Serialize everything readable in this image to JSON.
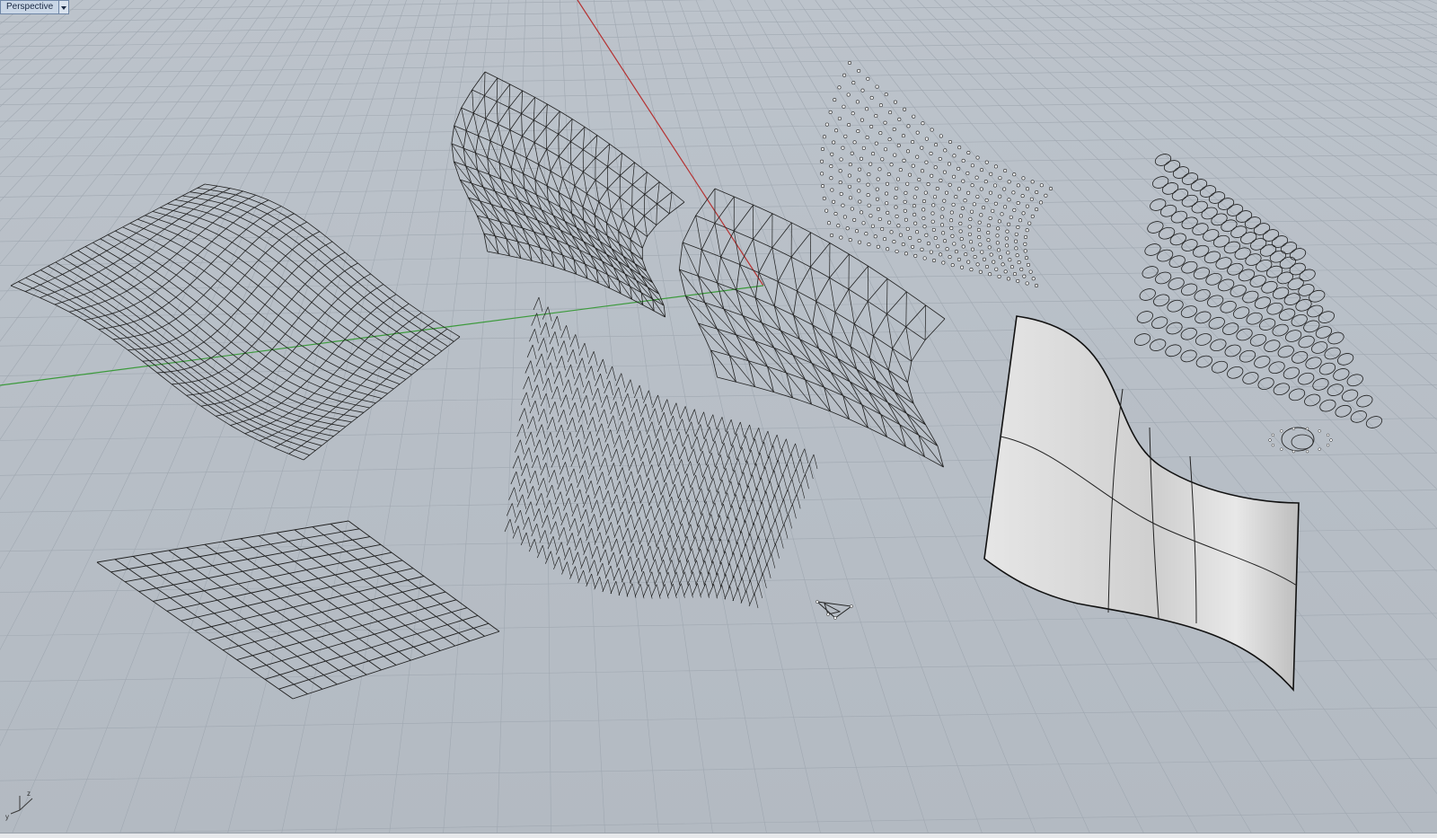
{
  "viewport": {
    "name": "Perspective",
    "background": "#b9c0c8",
    "grid_color": "#9ea6af",
    "x_axis_color": "#b53232",
    "y_axis_color": "#3c9a3c",
    "wire_color": "#1f1f1f",
    "axis_icon": {
      "z": "z",
      "y": "y",
      "x": "x"
    }
  }
}
